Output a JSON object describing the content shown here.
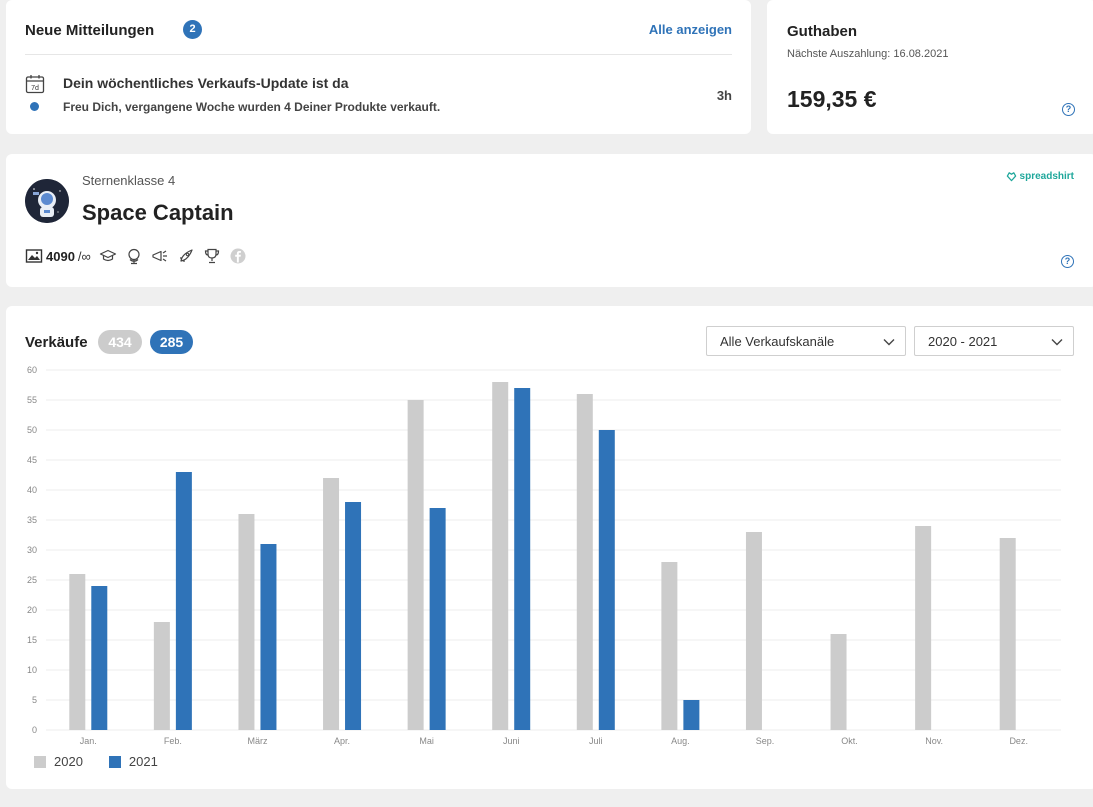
{
  "notifications": {
    "title": "Neue Mitteilungen",
    "badge_count": "2",
    "show_all": "Alle anzeigen",
    "item": {
      "calendar_label": "7d",
      "headline": "Dein wöchentliches Verkaufs-Update ist da",
      "body": "Freu Dich, vergangene Woche wurden 4 Deiner Produkte verkauft.",
      "time": "3h"
    }
  },
  "balance": {
    "title": "Guthaben",
    "next_payout": "Nächste Auszahlung: 16.08.2021",
    "amount": "159,35 €",
    "help": "?"
  },
  "profile": {
    "rank": "Sternenklasse 4",
    "name": "Space Captain",
    "brand": "spreadshirt",
    "design_count": "4090",
    "design_limit": "/∞",
    "help": "?",
    "badges": [
      "graduation-cap-icon",
      "globe-icon",
      "megaphone-icon",
      "rocket-icon",
      "trophy-icon",
      "facebook-icon"
    ]
  },
  "sales": {
    "title": "Verkäufe",
    "total_2020": "434",
    "total_2021": "285",
    "channel_select": "Alle Verkaufskanäle",
    "years_select": "2020 - 2021"
  },
  "colors": {
    "accent": "#2f73b8",
    "series_2020": "#cccccc",
    "series_2021": "#2f73b8",
    "brand": "#1fa79b"
  },
  "chart_data": {
    "type": "bar",
    "categories": [
      "Jan.",
      "Feb.",
      "März",
      "Apr.",
      "Mai",
      "Juni",
      "Juli",
      "Aug.",
      "Sep.",
      "Okt.",
      "Nov.",
      "Dez."
    ],
    "series": [
      {
        "name": "2020",
        "values": [
          26,
          18,
          36,
          42,
          55,
          58,
          56,
          28,
          33,
          16,
          34,
          32
        ]
      },
      {
        "name": "2021",
        "values": [
          24,
          43,
          31,
          38,
          37,
          57,
          50,
          5,
          null,
          null,
          null,
          null
        ]
      }
    ],
    "ylim": [
      0,
      60
    ],
    "yticks": [
      0,
      5,
      10,
      15,
      20,
      25,
      30,
      35,
      40,
      45,
      50,
      55,
      60
    ],
    "grid": true,
    "legend": "bottom-left",
    "title": "",
    "xlabel": "",
    "ylabel": ""
  }
}
